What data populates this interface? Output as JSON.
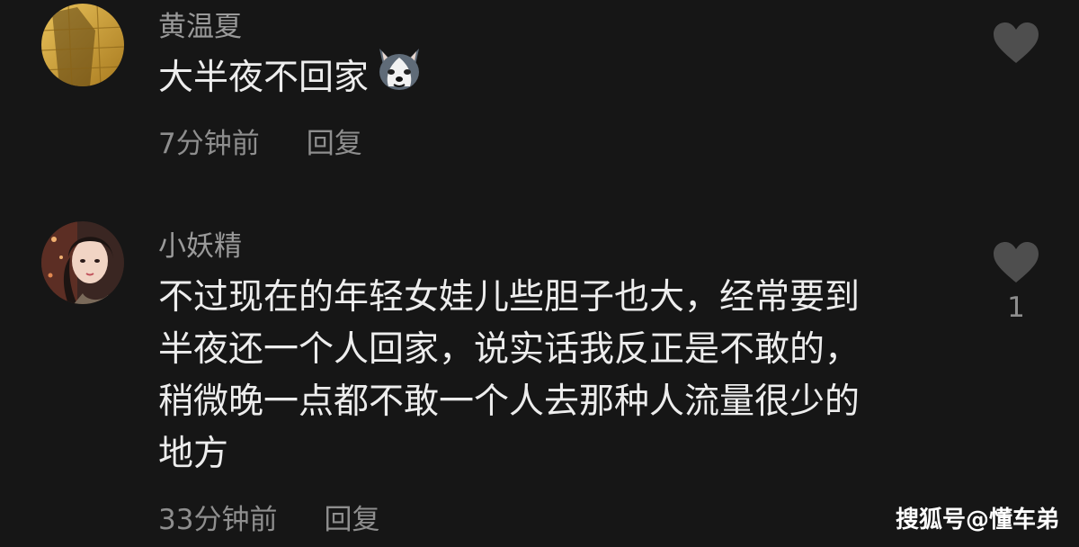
{
  "comments": [
    {
      "username": "黄温夏",
      "text_lines": [
        "大半夜不回家"
      ],
      "emoji_icon": "husky-dog-face-icon",
      "time": "7分钟前",
      "reply_label": "回复",
      "like_icon": "heart-icon",
      "like_count": ""
    },
    {
      "username": "小妖精",
      "text_lines": [
        "不过现在的年轻女娃儿些胆子也大，经常要到",
        "半夜还一个人回家，说实话我反正是不敢的，",
        "稍微晚一点都不敢一个人去那种人流量很少的",
        "地方"
      ],
      "time": "33分钟前",
      "reply_label": "回复",
      "like_icon": "heart-icon",
      "like_count": "1"
    }
  ],
  "watermark": "搜狐号@懂车弟",
  "colors": {
    "background": "#161616",
    "username": "#9a9a9a",
    "text": "#ededed",
    "meta": "#8e8e8e",
    "heart": "#4e4e4e"
  }
}
